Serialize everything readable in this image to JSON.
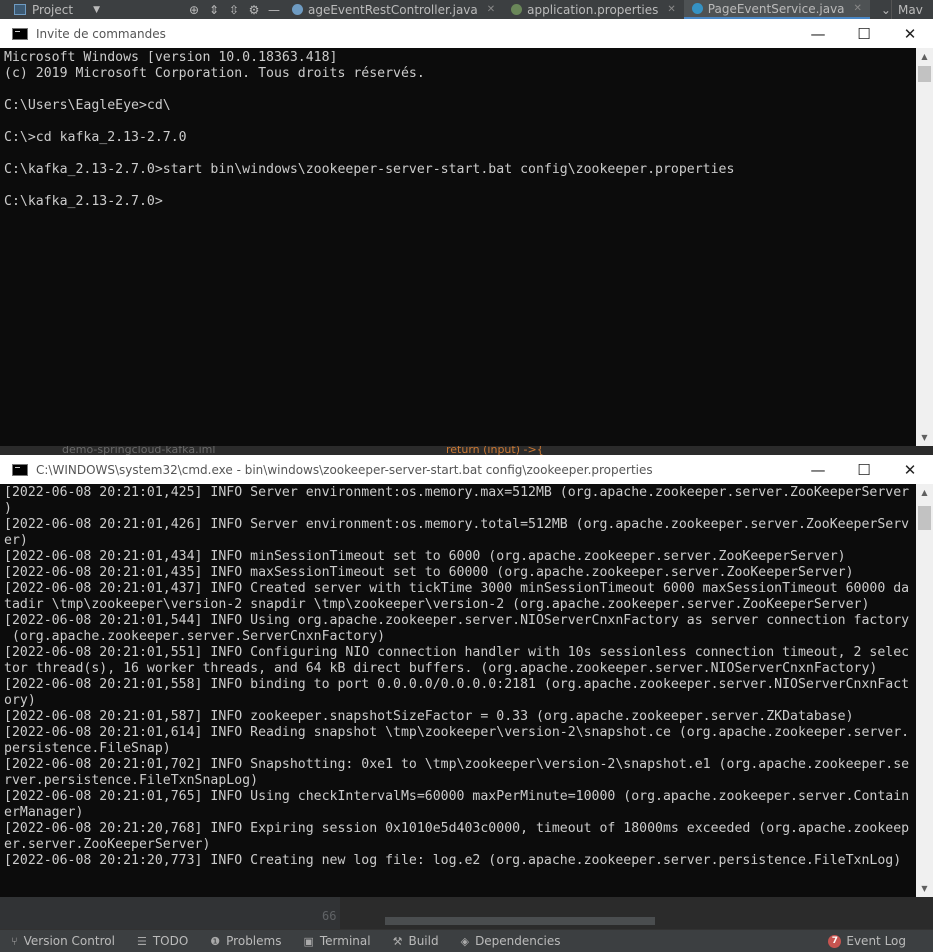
{
  "ide": {
    "project_label": "Project",
    "tabs": [
      {
        "label": "ageEventRestController.java",
        "active": false,
        "color": "#6e9bc2"
      },
      {
        "label": "application.properties",
        "active": false,
        "color": "#6a8759"
      },
      {
        "label": "PageEventService.java",
        "active": true,
        "color": "#3592c4"
      }
    ],
    "maven_label": "Mav",
    "behind_left": "demo-springcloud-kafka.iml",
    "behind_code": "return (input) ->{",
    "line_66": "66"
  },
  "console1": {
    "title": "Invite de commandes",
    "lines": [
      "Microsoft Windows [version 10.0.18363.418]",
      "(c) 2019 Microsoft Corporation. Tous droits réservés.",
      "",
      "C:\\Users\\EagleEye>cd\\",
      "",
      "C:\\>cd kafka_2.13-2.7.0",
      "",
      "C:\\kafka_2.13-2.7.0>start bin\\windows\\zookeeper-server-start.bat config\\zookeeper.properties",
      "",
      "C:\\kafka_2.13-2.7.0>"
    ]
  },
  "console2": {
    "title": "C:\\WINDOWS\\system32\\cmd.exe - bin\\windows\\zookeeper-server-start.bat  config\\zookeeper.properties",
    "lines": [
      "[2022-06-08 20:21:01,425] INFO Server environment:os.memory.max=512MB (org.apache.zookeeper.server.ZooKeeperServer",
      ")",
      "[2022-06-08 20:21:01,426] INFO Server environment:os.memory.total=512MB (org.apache.zookeeper.server.ZooKeeperServ",
      "er)",
      "[2022-06-08 20:21:01,434] INFO minSessionTimeout set to 6000 (org.apache.zookeeper.server.ZooKeeperServer)",
      "[2022-06-08 20:21:01,435] INFO maxSessionTimeout set to 60000 (org.apache.zookeeper.server.ZooKeeperServer)",
      "[2022-06-08 20:21:01,437] INFO Created server with tickTime 3000 minSessionTimeout 6000 maxSessionTimeout 60000 da",
      "tadir \\tmp\\zookeeper\\version-2 snapdir \\tmp\\zookeeper\\version-2 (org.apache.zookeeper.server.ZooKeeperServer)",
      "[2022-06-08 20:21:01,544] INFO Using org.apache.zookeeper.server.NIOServerCnxnFactory as server connection factory",
      " (org.apache.zookeeper.server.ServerCnxnFactory)",
      "[2022-06-08 20:21:01,551] INFO Configuring NIO connection handler with 10s sessionless connection timeout, 2 selec",
      "tor thread(s), 16 worker threads, and 64 kB direct buffers. (org.apache.zookeeper.server.NIOServerCnxnFactory)",
      "[2022-06-08 20:21:01,558] INFO binding to port 0.0.0.0/0.0.0.0:2181 (org.apache.zookeeper.server.NIOServerCnxnFact",
      "ory)",
      "[2022-06-08 20:21:01,587] INFO zookeeper.snapshotSizeFactor = 0.33 (org.apache.zookeeper.server.ZKDatabase)",
      "[2022-06-08 20:21:01,614] INFO Reading snapshot \\tmp\\zookeeper\\version-2\\snapshot.ce (org.apache.zookeeper.server.",
      "persistence.FileSnap)",
      "[2022-06-08 20:21:01,702] INFO Snapshotting: 0xe1 to \\tmp\\zookeeper\\version-2\\snapshot.e1 (org.apache.zookeeper.se",
      "rver.persistence.FileTxnSnapLog)",
      "[2022-06-08 20:21:01,765] INFO Using checkIntervalMs=60000 maxPerMinute=10000 (org.apache.zookeeper.server.Contain",
      "erManager)",
      "[2022-06-08 20:21:20,768] INFO Expiring session 0x1010e5d403c0000, timeout of 18000ms exceeded (org.apache.zookeep",
      "er.server.ZooKeeperServer)",
      "[2022-06-08 20:21:20,773] INFO Creating new log file: log.e2 (org.apache.zookeeper.server.persistence.FileTxnLog)"
    ]
  },
  "window_controls": {
    "minimize": "—",
    "maximize": "☐",
    "close": "✕"
  },
  "statusbar": {
    "items": [
      {
        "label": "Version Control",
        "icon": "version-control-icon",
        "glyph": "⑂"
      },
      {
        "label": "TODO",
        "icon": "todo-icon",
        "glyph": "☰"
      },
      {
        "label": "Problems",
        "icon": "problems-icon",
        "glyph": "❶"
      },
      {
        "label": "Terminal",
        "icon": "terminal-icon",
        "glyph": "▣"
      },
      {
        "label": "Build",
        "icon": "build-icon",
        "glyph": "⚒"
      },
      {
        "label": "Dependencies",
        "icon": "dependencies-icon",
        "glyph": "◈"
      }
    ],
    "event_log_count": "7",
    "event_log_label": "Event Log"
  }
}
